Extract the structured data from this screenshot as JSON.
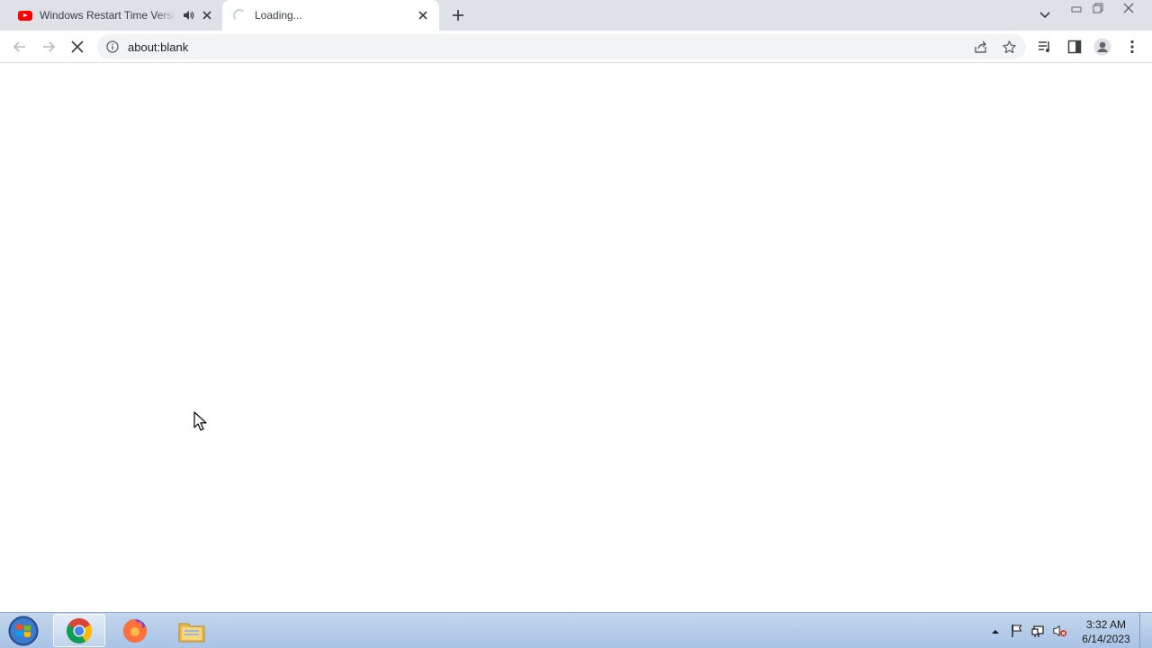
{
  "browser": {
    "tabs": [
      {
        "title": "Windows Restart Time Version",
        "favicon": "youtube-icon",
        "audio": "speaker-icon",
        "active": false
      },
      {
        "title": "Loading...",
        "favicon": "loading-spinner-icon",
        "active": true
      }
    ],
    "toolbar": {
      "url": "about:blank"
    }
  },
  "taskbar": {
    "apps": [
      "chrome-icon",
      "firefox-icon",
      "file-explorer-icon"
    ],
    "clock": {
      "time": "3:32 AM",
      "date": "6/14/2023"
    }
  },
  "colors": {
    "tabstrip": "#dee1e6",
    "omnibox": "#f1f3f4",
    "youtube_red": "#ff0000"
  }
}
